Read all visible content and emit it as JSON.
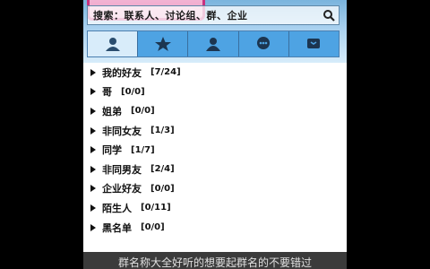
{
  "search": {
    "placeholder": "搜索：联系人、讨论组、群、企业"
  },
  "tabs": [
    {
      "icon": "contacts-icon"
    },
    {
      "icon": "star-icon"
    },
    {
      "icon": "group-icon"
    },
    {
      "icon": "chat-icon"
    },
    {
      "icon": "recent-icon"
    }
  ],
  "groups": [
    {
      "name": "我的好友",
      "count": "[7/24]"
    },
    {
      "name": "哥",
      "count": "[0/0]"
    },
    {
      "name": "姐弟",
      "count": "[0/0]"
    },
    {
      "name": "非同女友",
      "count": "[1/3]"
    },
    {
      "name": "同学",
      "count": "[1/7]"
    },
    {
      "name": "非同男友",
      "count": "[2/4]"
    },
    {
      "name": "企业好友",
      "count": "[0/0]"
    },
    {
      "name": "陌生人",
      "count": "[0/11]"
    },
    {
      "name": "黑名单",
      "count": "[0/0]"
    }
  ],
  "caption": "群名称大全好听的想要起群名的不要错过"
}
